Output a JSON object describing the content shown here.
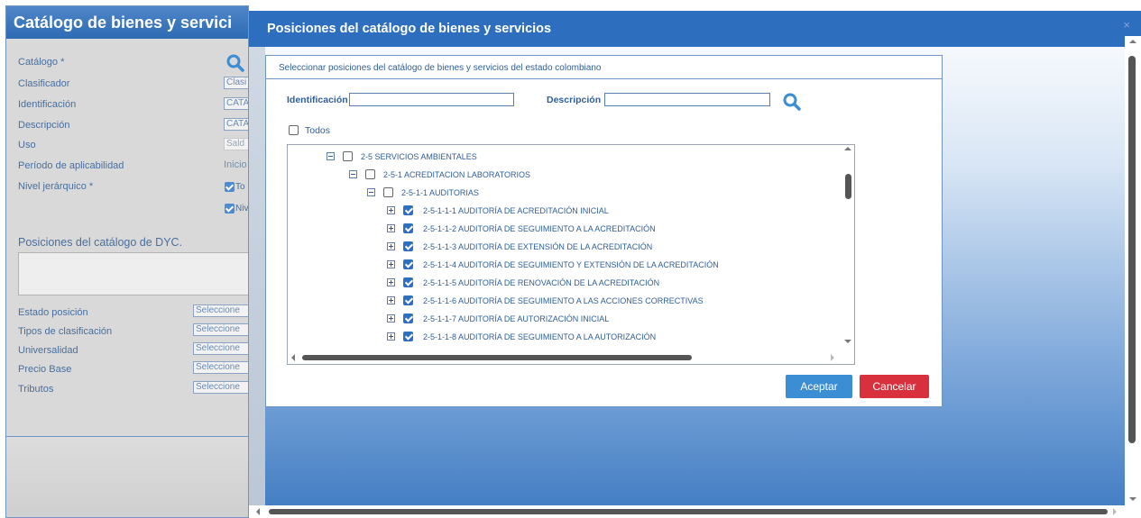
{
  "background_window": {
    "title": "Catálogo de bienes y servici",
    "fields": [
      {
        "label": "Catálogo *",
        "value": ""
      },
      {
        "label": "Clasificador",
        "value": "Clasi"
      },
      {
        "label": "Identificación",
        "value": "CATA"
      },
      {
        "label": "Descripción",
        "value": "CATA"
      },
      {
        "label": "Uso",
        "value": "Sald"
      },
      {
        "label": "Período de aplicabilidad",
        "value": "Inicio"
      },
      {
        "label": "Nivel jerárquico *",
        "value": ""
      }
    ],
    "nivel_options": [
      "To",
      "Niv"
    ],
    "positions_label": "Posiciones del catálogo de DYC.",
    "selects": [
      {
        "label": "Estado posición",
        "value": "Seleccione"
      },
      {
        "label": "Tipos de clasificación",
        "value": "Seleccione"
      },
      {
        "label": "Universalidad",
        "value": "Seleccione"
      },
      {
        "label": "Precio Base",
        "value": "Seleccione"
      },
      {
        "label": "Tributos",
        "value": "Seleccione"
      }
    ]
  },
  "modal": {
    "title": "Posiciones del catálogo de bienes y servicios",
    "close_symbol": "×",
    "panel_header": "Seleccionar posiciones del catálogo de bienes y servicios del estado colombiano",
    "identificacion_label": "Identificación",
    "descripcion_label": "Descripción",
    "identificacion_value": "",
    "descripcion_value": "",
    "todos_label": "Todos",
    "accept_label": "Aceptar",
    "cancel_label": "Cancelar"
  },
  "tree": [
    {
      "label": "2-5 SERVICIOS AMBIENTALES",
      "level": 0,
      "toggle": "minus",
      "checked": false
    },
    {
      "label": "2-5-1 ACREDITACION LABORATORIOS",
      "level": 1,
      "toggle": "minus",
      "checked": false
    },
    {
      "label": "2-5-1-1 AUDITORIAS",
      "level": 2,
      "toggle": "minus",
      "checked": false
    },
    {
      "label": "2-5-1-1-1 AUDITORÍA DE ACREDITACIÓN INICIAL",
      "level": 3,
      "toggle": "plus",
      "checked": true
    },
    {
      "label": "2-5-1-1-2 AUDITORÍA DE SEGUIMIENTO A LA ACREDITACIÓN",
      "level": 3,
      "toggle": "plus",
      "checked": true
    },
    {
      "label": "2-5-1-1-3 AUDITORÍA DE EXTENSIÓN DE LA ACREDITACIÓN",
      "level": 3,
      "toggle": "plus",
      "checked": true
    },
    {
      "label": "2-5-1-1-4 AUDITORÍA DE SEGUIMIENTO Y EXTENSIÓN DE LA ACREDITACIÓN",
      "level": 3,
      "toggle": "plus",
      "checked": true
    },
    {
      "label": "2-5-1-1-5 AUDITORÍA DE RENOVACIÓN DE LA ACREDITACIÓN",
      "level": 3,
      "toggle": "plus",
      "checked": true
    },
    {
      "label": "2-5-1-1-6 AUDITORÍA DE SEGUIMIENTO A LAS ACCIONES CORRECTIVAS",
      "level": 3,
      "toggle": "plus",
      "checked": true
    },
    {
      "label": "2-5-1-1-7 AUDITORÍA DE AUTORIZACIÓN INICIAL",
      "level": 3,
      "toggle": "plus",
      "checked": true
    },
    {
      "label": "2-5-1-1-8 AUDITORÍA DE SEGUIMIENTO A LA AUTORIZACIÓN",
      "level": 3,
      "toggle": "plus",
      "checked": true
    }
  ],
  "colors": {
    "title_bar": "#2d6fbe",
    "accent": "#3b8ed4",
    "danger": "#d9303e",
    "text": "#2f5e97"
  }
}
